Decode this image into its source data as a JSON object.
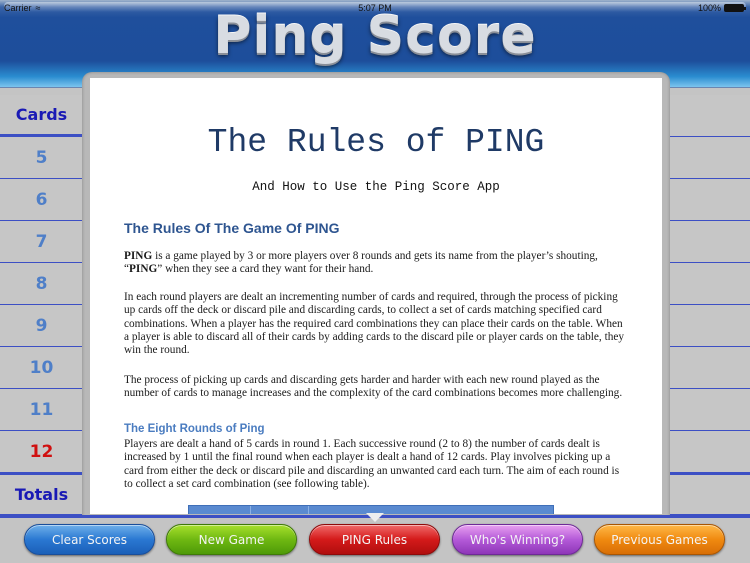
{
  "status_bar": {
    "carrier": "Carrier",
    "time": "5:07 PM",
    "battery": "100%"
  },
  "header": {
    "title": "Ping Score"
  },
  "cards_column": {
    "header": "Cards",
    "rounds": [
      "5",
      "6",
      "7",
      "8",
      "9",
      "10",
      "11",
      "12"
    ],
    "current_round": "12",
    "totals": "Totals"
  },
  "document": {
    "title": "The Rules of PING",
    "subtitle": "And How to Use the Ping Score App",
    "section1_heading": "The Rules Of The Game Of PING",
    "p1_bold1": "PING",
    "p1_text1": " is a game played by 3 or more players over 8 rounds and gets its name from the player’s shouting, “",
    "p1_bold2": "PING",
    "p1_text2": "” when they see a card they want for their hand.",
    "p2": "In each round players are dealt an incrementing number of cards and required, through the process of picking up cards off the deck or discard pile and discarding cards, to collect a set of cards matching specified card combinations. When a player has the required card combinations they can place their cards on the table. When a player is able to discard all of their cards by adding cards to the discard pile or player cards on the table, they win the round.",
    "p3": "The process of picking up cards and discarding gets harder and harder with each new round played as the number of cards to manage increases and the complexity of the card combinations becomes more challenging.",
    "section2_heading": "The Eight Rounds of Ping",
    "p4": "Players are dealt a hand of 5 cards in round 1. Each successive round (2 to 8) the number of cards dealt is increased by 1 until the final round when each player is dealt a hand of 12 cards. Play involves picking up a card from either the deck or discard pile and discarding an unwanted card each turn. The aim of each round is to collect a set card combination (see following table)."
  },
  "toolbar": {
    "clear_scores": "Clear Scores",
    "new_game": "New Game",
    "ping_rules": "PING Rules",
    "whos_winning": "Who's Winning?",
    "previous_games": "Previous Games",
    "active": "PING Rules"
  },
  "colors": {
    "header_blue": "#1d4e9b",
    "rule_line": "#3c4fc4",
    "round_text": "#4f7fc8",
    "current_round": "#d01010",
    "heading_blue": "#2e5590"
  }
}
